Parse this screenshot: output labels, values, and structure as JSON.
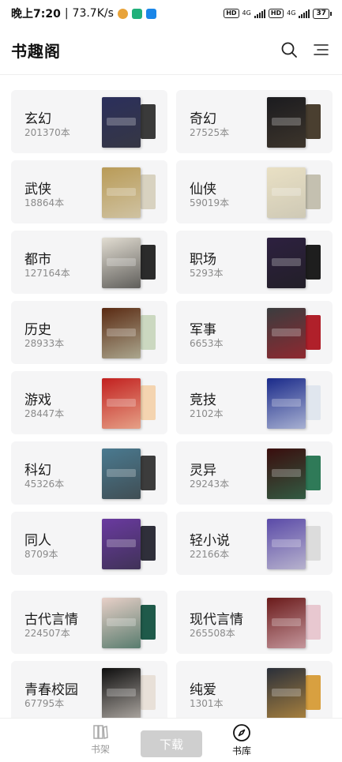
{
  "status_bar": {
    "time": "晚上7:20",
    "speed": "73.7K/s",
    "hd": "HD",
    "net": "4G",
    "battery": "37"
  },
  "header": {
    "title": "书趣阁"
  },
  "categories": [
    {
      "name": "玄幻",
      "count": "201370本",
      "front": "#2b2f5c",
      "back": "#3a3a3a"
    },
    {
      "name": "奇幻",
      "count": "27525本",
      "front": "#1b1b1f",
      "back": "#4a3f30"
    },
    {
      "name": "武侠",
      "count": "18864本",
      "front": "#b99b57",
      "back": "#d8d2c0"
    },
    {
      "name": "仙侠",
      "count": "59019本",
      "front": "#e9e0c4",
      "back": "#c4c0b0"
    },
    {
      "name": "都市",
      "count": "127164本",
      "front": "#e2ddd2",
      "back": "#2b2b2b"
    },
    {
      "name": "职场",
      "count": "5293本",
      "front": "#2d2040",
      "back": "#1e1e1e"
    },
    {
      "name": "历史",
      "count": "28933本",
      "front": "#5a2a12",
      "back": "#cbd8c0"
    },
    {
      "name": "军事",
      "count": "6653本",
      "front": "#3a3d3f",
      "back": "#b0202a"
    },
    {
      "name": "游戏",
      "count": "28447本",
      "front": "#c2201f",
      "back": "#f4d4b0"
    },
    {
      "name": "竞技",
      "count": "2102本",
      "front": "#1a2a8a",
      "back": "#e0e6ee"
    },
    {
      "name": "科幻",
      "count": "45326本",
      "front": "#4a7a90",
      "back": "#3c3c3c"
    },
    {
      "name": "灵异",
      "count": "29243本",
      "front": "#3a0d0d",
      "back": "#2f7a58"
    },
    {
      "name": "同人",
      "count": "8709本",
      "front": "#6a3aa0",
      "back": "#2f2f3a"
    },
    {
      "name": "轻小说",
      "count": "22166本",
      "front": "#5a4aa8",
      "back": "#dcdcdc"
    },
    {
      "name": "古代言情",
      "count": "224507本",
      "front": "#e8d0c8",
      "back": "#1f5a4a"
    },
    {
      "name": "现代言情",
      "count": "265508本",
      "front": "#6a1a1a",
      "back": "#e8c8d0"
    },
    {
      "name": "青春校园",
      "count": "67795本",
      "front": "#0e0e0e",
      "back": "#e8e0d8"
    },
    {
      "name": "纯爱",
      "count": "1301本",
      "front": "#2a2f3a",
      "back": "#d8a040"
    }
  ],
  "bottom_nav": {
    "shelf_label": "书架",
    "download_label": "下载",
    "store_label": "书库"
  },
  "icons": {
    "search": "search-icon",
    "filter": "list-filter-icon",
    "shelf": "bookshelf-icon",
    "store": "compass-icon"
  }
}
